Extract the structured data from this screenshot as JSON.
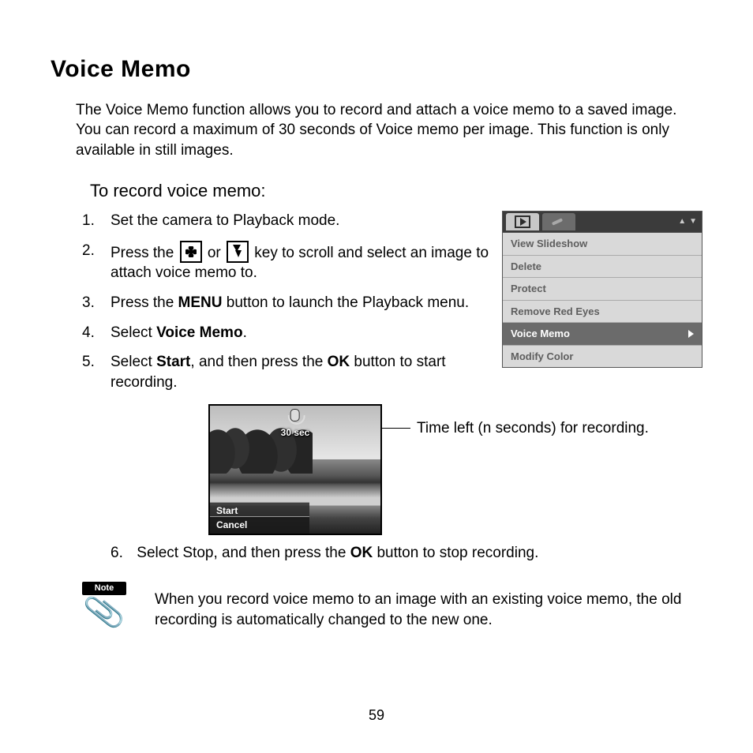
{
  "title": "Voice Memo",
  "intro": "The Voice Memo function allows you to record and attach a voice memo to a saved image. You can record a maximum of 30 seconds of Voice memo per image. This function is only available in still images.",
  "subheading": "To record voice memo:",
  "steps": {
    "s1": "Set the camera to Playback mode.",
    "s2a": "Press the ",
    "s2b": " or ",
    "s2c": " key to scroll and select an image to attach voice memo to.",
    "s3a": "Press the ",
    "s3b": "MENU",
    "s3c": " button to launch the Playback menu.",
    "s4a": "Select ",
    "s4b": "Voice Memo",
    "s4c": ".",
    "s5a": "Select ",
    "s5b": "Start",
    "s5c": ", and then press the ",
    "s5d": "OK",
    "s5e": " button to start recording.",
    "s6a": "Select Stop, and then press the ",
    "s6b": "OK",
    "s6c": " button to stop recording."
  },
  "menu": {
    "items": [
      "View Slideshow",
      "Delete",
      "Protect",
      "Remove Red Eyes",
      "Voice Memo",
      "Modify Color"
    ],
    "selected_index": 4
  },
  "preview": {
    "time_label": "30 sec",
    "option_start": "Start",
    "option_cancel": "Cancel"
  },
  "callout": "Time left (n seconds) for recording.",
  "note": {
    "badge": "Note",
    "text": "When you record voice memo to an image with an existing voice memo, the old recording is automatically changed to the new one."
  },
  "page_number": "59"
}
